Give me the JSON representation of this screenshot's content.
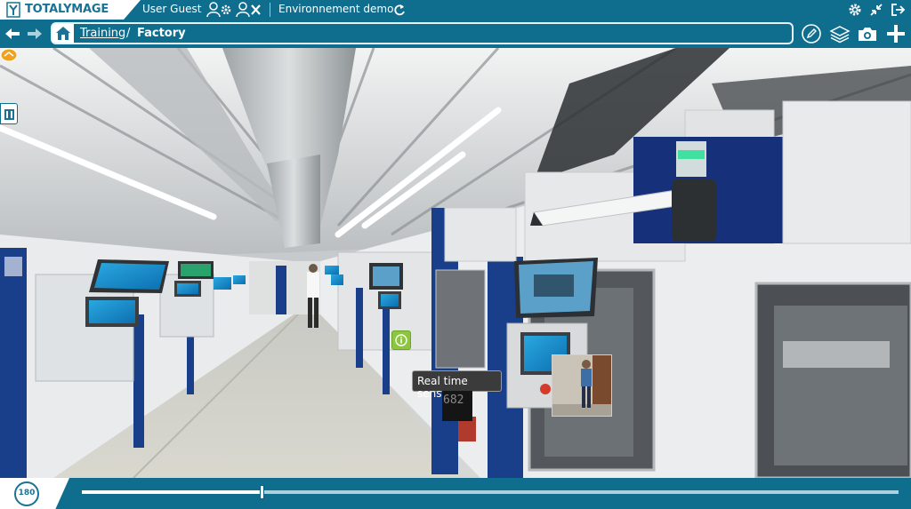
{
  "header": {
    "brand": "TOTALYMAGE",
    "user": "User Guest",
    "environment": "Environnement demo",
    "icons": [
      "user-settings-icon",
      "user-remove-icon",
      "refresh-icon",
      "settings-icon",
      "collapse-icon",
      "logout-icon"
    ]
  },
  "nav": {
    "breadcrumb": {
      "link": "Training",
      "separator": "/",
      "current": "Factory"
    },
    "icons": [
      "back-arrow-icon",
      "forward-arrow-icon",
      "home-icon",
      "edit-icon",
      "layers-icon",
      "camera-icon",
      "add-icon"
    ]
  },
  "viewer": {
    "tooltip": "Real time sensor",
    "sensor_value": "682",
    "hotspots": [
      "info-hotspot",
      "link-hotspot",
      "photo-hotspot"
    ]
  },
  "footer": {
    "rotate_label": "180",
    "timeline_progress": 0.22
  },
  "colors": {
    "brand": "#0f6e8e",
    "accent_light": "#a9d2df",
    "hotspot_green": "#8cc63f"
  }
}
